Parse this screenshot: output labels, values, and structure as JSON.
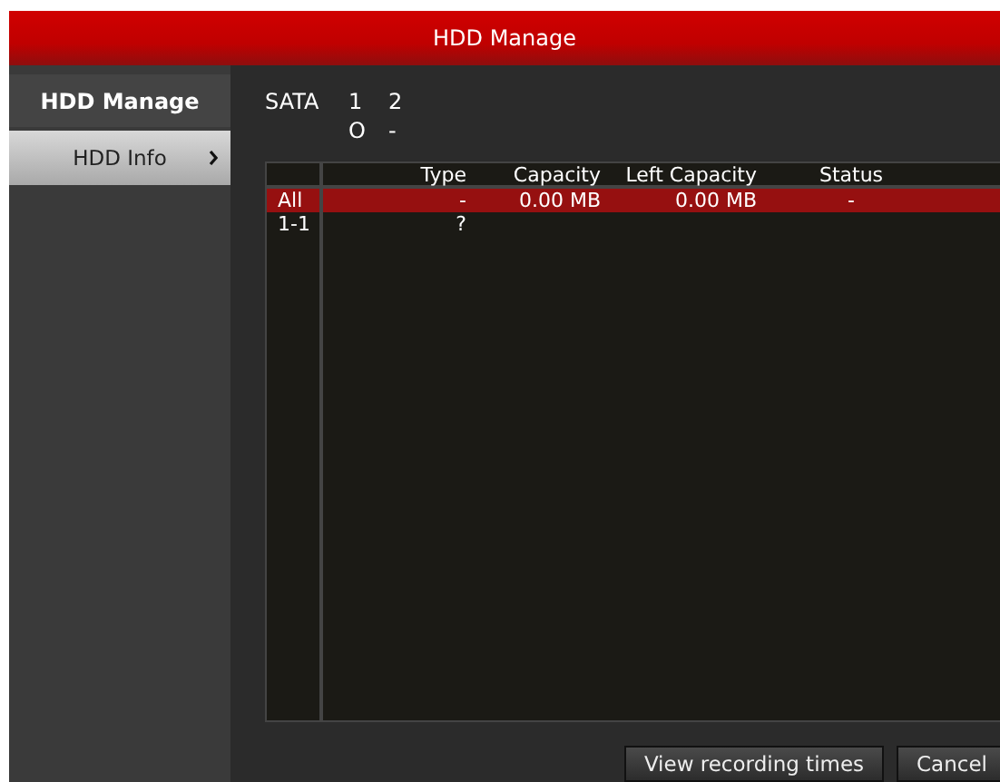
{
  "window": {
    "title": "HDD Manage"
  },
  "sidebar": {
    "heading": "HDD Manage",
    "items": [
      {
        "label": "HDD Info",
        "selected": true
      }
    ]
  },
  "sata": {
    "label": "SATA",
    "ports": [
      {
        "number": "1",
        "status": "O"
      },
      {
        "number": "2",
        "status": "-"
      }
    ]
  },
  "table": {
    "columns": [
      "",
      "Type",
      "Capacity",
      "Left Capacity",
      "Status"
    ],
    "rows": [
      {
        "cells": [
          "All",
          "-",
          "0.00 MB",
          "0.00 MB",
          "-"
        ],
        "selected": true
      },
      {
        "cells": [
          "1-1",
          "?",
          "",
          "",
          ""
        ],
        "selected": false
      }
    ]
  },
  "buttons": [
    "View recording times",
    "Cancel"
  ]
}
